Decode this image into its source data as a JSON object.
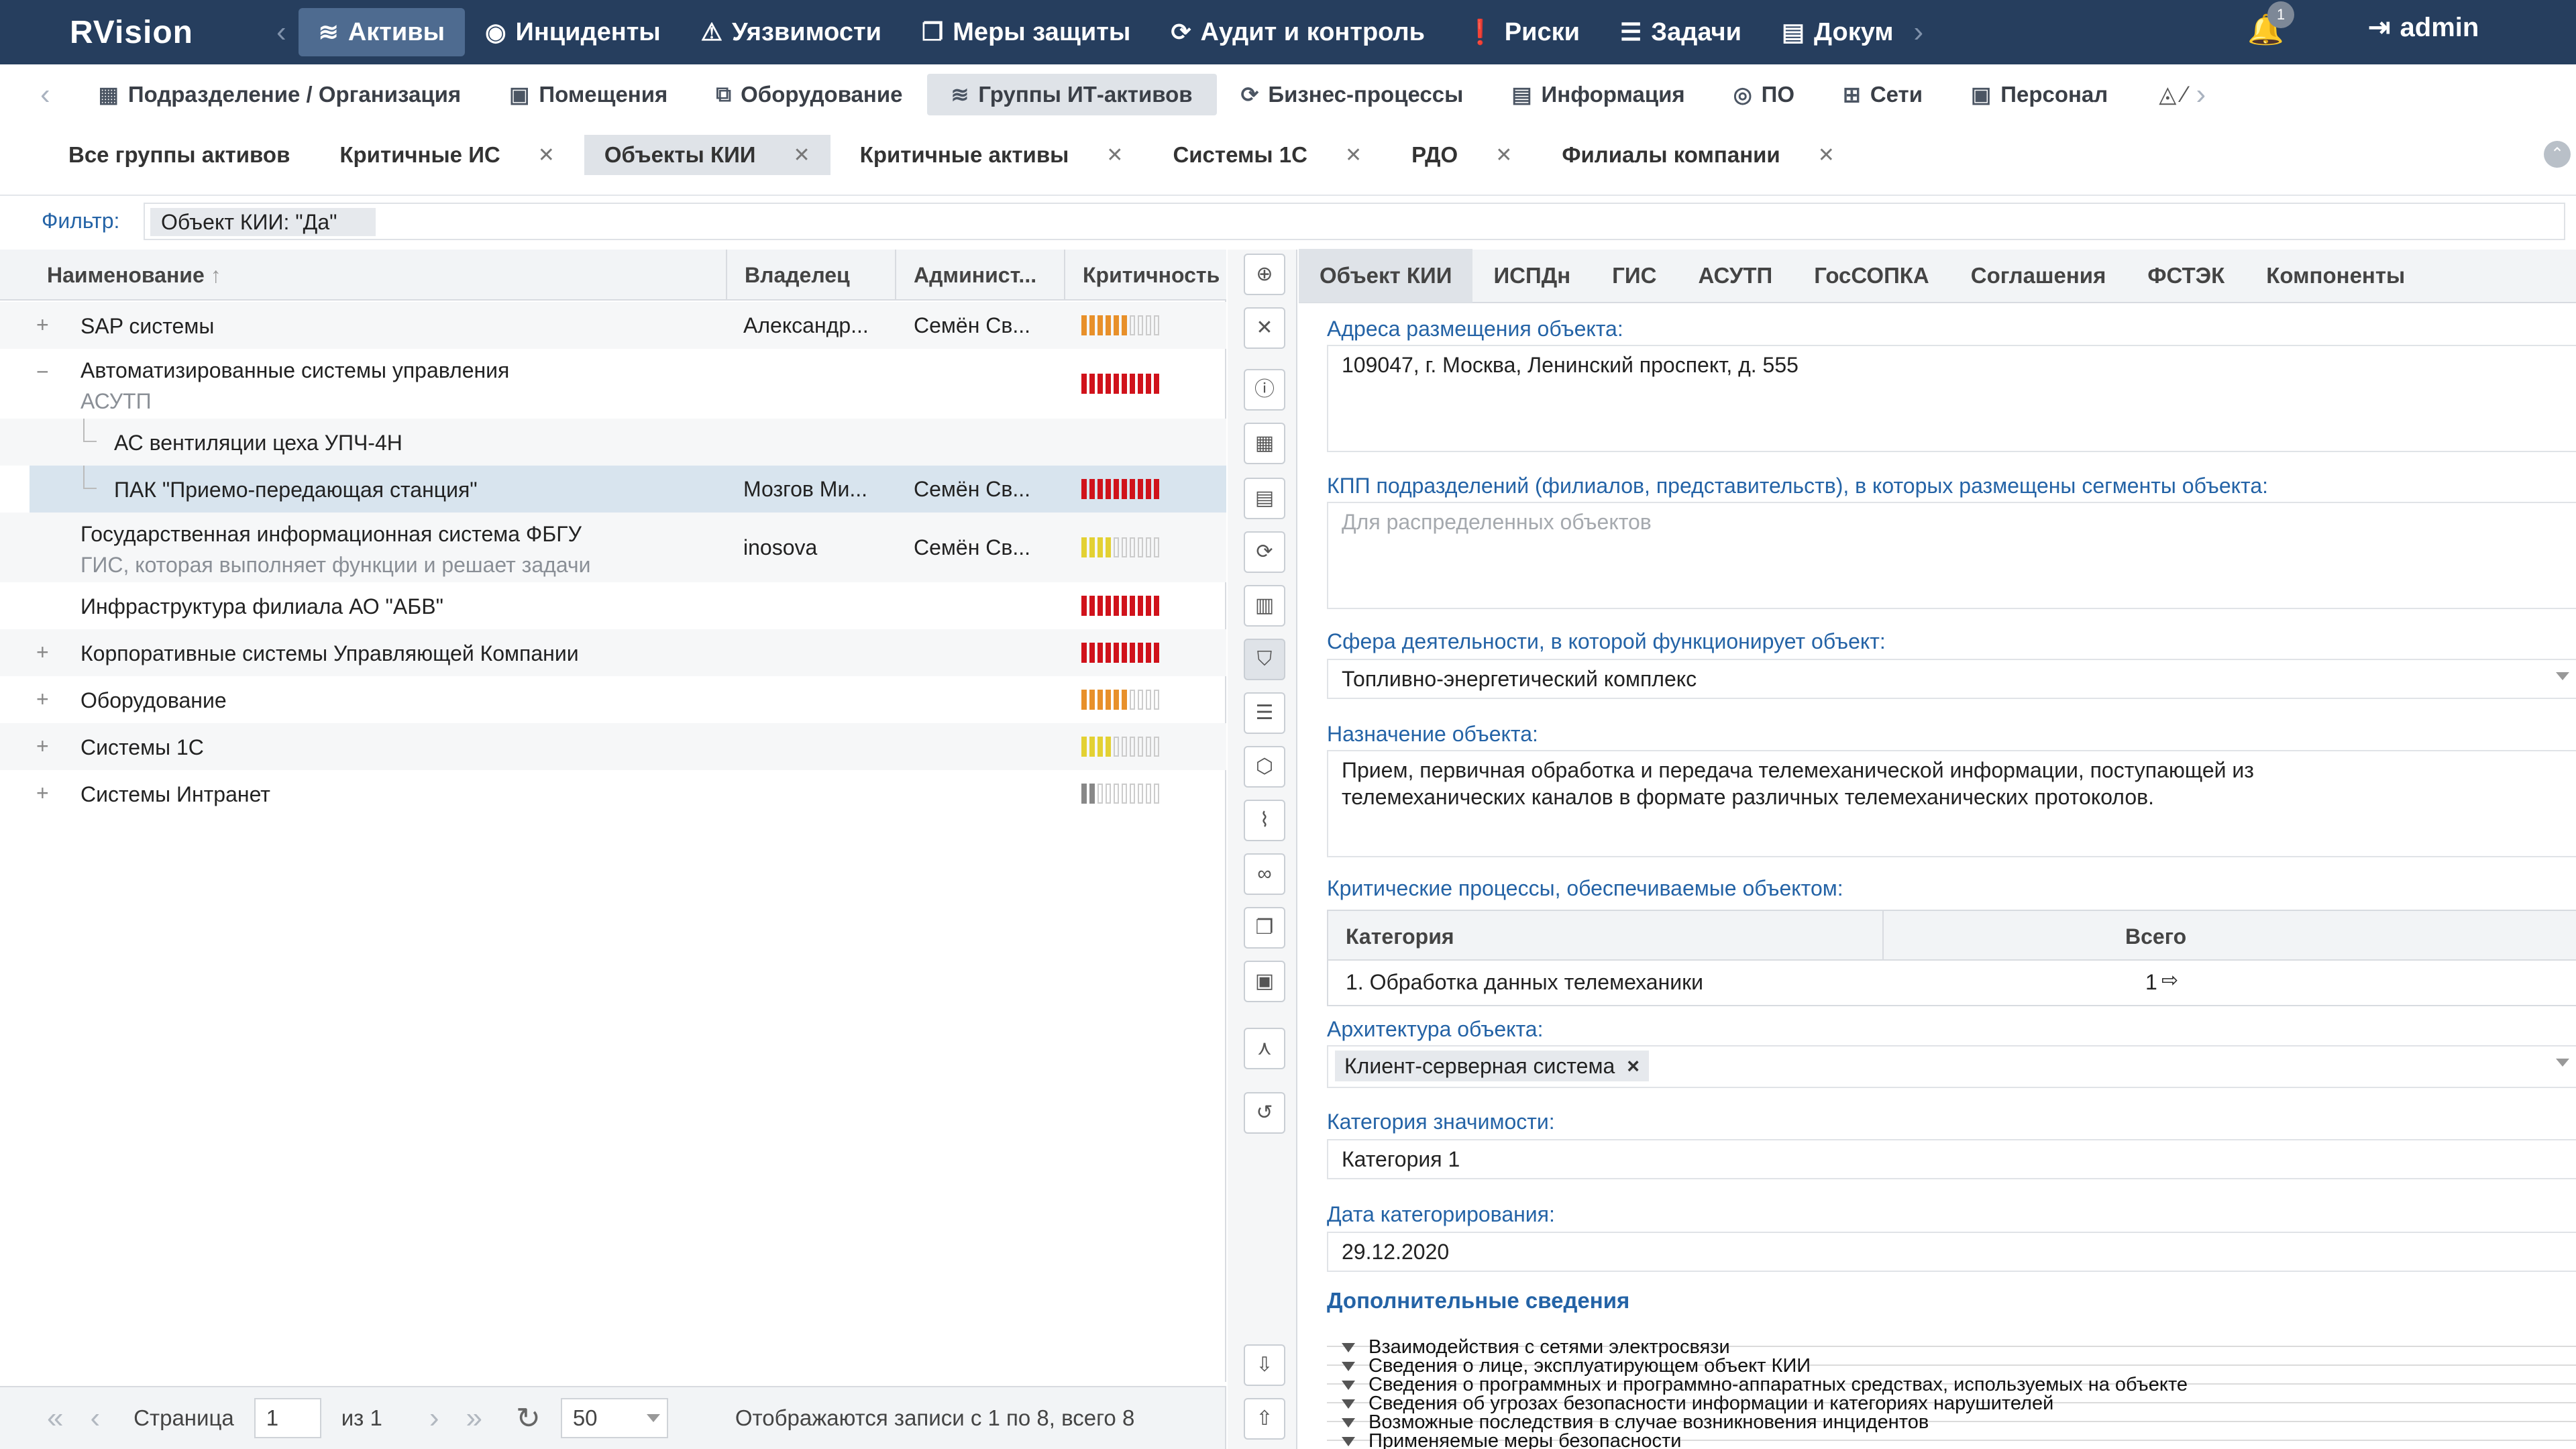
{
  "topnav": {
    "logo": "RVision",
    "items": [
      {
        "label": "Активы",
        "icon": "database-icon",
        "glyph": "≋"
      },
      {
        "label": "Инциденты",
        "icon": "target-icon",
        "glyph": "◉"
      },
      {
        "label": "Уязвимости",
        "icon": "warning-icon",
        "glyph": "⚠"
      },
      {
        "label": "Меры защиты",
        "icon": "copy-icon",
        "glyph": "❐"
      },
      {
        "label": "Аудит и контроль",
        "icon": "refresh-icon",
        "glyph": "⟳"
      },
      {
        "label": "Риски",
        "icon": "alert-circle-icon",
        "glyph": "❗"
      },
      {
        "label": "Задачи",
        "icon": "tasks-icon",
        "glyph": "☰"
      },
      {
        "label": "Докум",
        "icon": "document-icon",
        "glyph": "▤"
      }
    ],
    "notifications_count": "1",
    "user": "admin"
  },
  "subnav": {
    "items": [
      {
        "label": "Подразделение / Организация",
        "glyph": "▦"
      },
      {
        "label": "Помещения",
        "glyph": "▣"
      },
      {
        "label": "Оборудование",
        "glyph": "⧉"
      },
      {
        "label": "Группы ИТ-активов",
        "glyph": "≋"
      },
      {
        "label": "Бизнес-процессы",
        "glyph": "⟳"
      },
      {
        "label": "Информация",
        "glyph": "▤"
      },
      {
        "label": "ПО",
        "glyph": "◎"
      },
      {
        "label": "Сети",
        "glyph": "⊞"
      },
      {
        "label": "Персонал",
        "glyph": "▣"
      }
    ]
  },
  "group_tabs": [
    {
      "label": "Все группы активов",
      "closable": false
    },
    {
      "label": "Критичные ИС",
      "closable": true
    },
    {
      "label": "Объекты КИИ",
      "closable": true
    },
    {
      "label": "Критичные активы",
      "closable": true
    },
    {
      "label": "Системы 1С",
      "closable": true
    },
    {
      "label": "РДО",
      "closable": true
    },
    {
      "label": "Филиалы компании",
      "closable": true
    }
  ],
  "filter": {
    "label": "Фильтр:",
    "value": "Объект КИИ: \"Да\""
  },
  "table": {
    "columns": [
      "Наименование",
      "Владелец",
      "Админист...",
      "Критичность"
    ],
    "rows": [
      {
        "name": "SAP системы",
        "sub": "",
        "owner": "Александр...",
        "admin": "Семён Св...",
        "crit_level": 6,
        "crit_color": "#e8902a"
      },
      {
        "name": "Автоматизированные системы управления",
        "sub": "АСУТП",
        "owner": "",
        "admin": "",
        "crit_level": 10,
        "crit_color": "#d0121b"
      },
      {
        "name": "АС вентиляции цеха УПЧ-4Н",
        "sub": "",
        "owner": "",
        "admin": "",
        "crit_level": 0,
        "crit_color": ""
      },
      {
        "name": "ПАК \"Приемо-передающая станция\"",
        "sub": "",
        "owner": "Мозгов Ми...",
        "admin": "Семён Св...",
        "crit_level": 10,
        "crit_color": "#d0121b"
      },
      {
        "name": "Государственная информационная система ФБГУ",
        "sub": "ГИС, которая выполняет функции и решает задачи",
        "owner": "inosova",
        "admin": "Семён Св...",
        "crit_level": 4,
        "crit_color": "#e3d133"
      },
      {
        "name": "Инфраструктура филиала АО \"АБВ\"",
        "sub": "",
        "owner": "",
        "admin": "",
        "crit_level": 10,
        "crit_color": "#d0121b"
      },
      {
        "name": "Корпоративные системы Управляющей Компании",
        "sub": "",
        "owner": "",
        "admin": "",
        "crit_level": 10,
        "crit_color": "#d0121b"
      },
      {
        "name": "Оборудование",
        "sub": "",
        "owner": "",
        "admin": "",
        "crit_level": 6,
        "crit_color": "#e8902a"
      },
      {
        "name": "Системы 1С",
        "sub": "",
        "owner": "",
        "admin": "",
        "crit_level": 4,
        "crit_color": "#e3d133"
      },
      {
        "name": "Системы Интранет",
        "sub": "",
        "owner": "",
        "admin": "",
        "crit_level": 2,
        "crit_color": "#888888"
      }
    ]
  },
  "pager": {
    "page_label": "Страница",
    "page": "1",
    "of_label": "из 1",
    "page_size": "50",
    "summary": "Отображаются записи с 1 по 8, всего 8"
  },
  "right": {
    "tabs": [
      "Объект КИИ",
      "ИСПДн",
      "ГИС",
      "АСУТП",
      "ГосСОПКА",
      "Соглашения",
      "ФСТЭК",
      "Компоненты"
    ],
    "address_label": "Адреса размещения объекта:",
    "address_value": "109047, г. Москва, Ленинский проспект, д. 555",
    "kpp_label": "КПП подразделений (филиалов, представительств), в которых размещены сегменты объекта:",
    "kpp_placeholder": "Для распределенных объектов",
    "sphere_label": "Сфера деятельности, в которой функционирует объект:",
    "sphere_value": "Топливно-энергетический комплекс",
    "purpose_label": "Назначение объекта:",
    "purpose_value": "Прием, первичная обработка и передача телемеханической информации, поступающей из телемеханических каналов в формате различных телемеханических протоколов.",
    "processes_label": "Критические процессы, обеспечиваемые объектом:",
    "processes_cols": [
      "Категория",
      "Всего"
    ],
    "processes_row": {
      "category": "1. Обработка данных телемеханики",
      "total": "1"
    },
    "arch_label": "Архитектура объекта:",
    "arch_chip": "Клиент-серверная система",
    "category_label": "Категория значимости:",
    "category_value": "Категория 1",
    "date_label": "Дата категорирования:",
    "date_value": "29.12.2020",
    "extra_title": "Дополнительные сведения",
    "accordion": [
      "Взаимодействия с сетями электросвязи",
      "Сведения о лице, эксплуатирующем объект КИИ",
      "Сведения о программных и программно-аппаратных средствах, используемых на объекте",
      "Сведения об угрозах безопасности информации и категориях нарушителей",
      "Возможные последствия в случае возникновения инцидентов",
      "Применяемые меры безопасности"
    ]
  }
}
